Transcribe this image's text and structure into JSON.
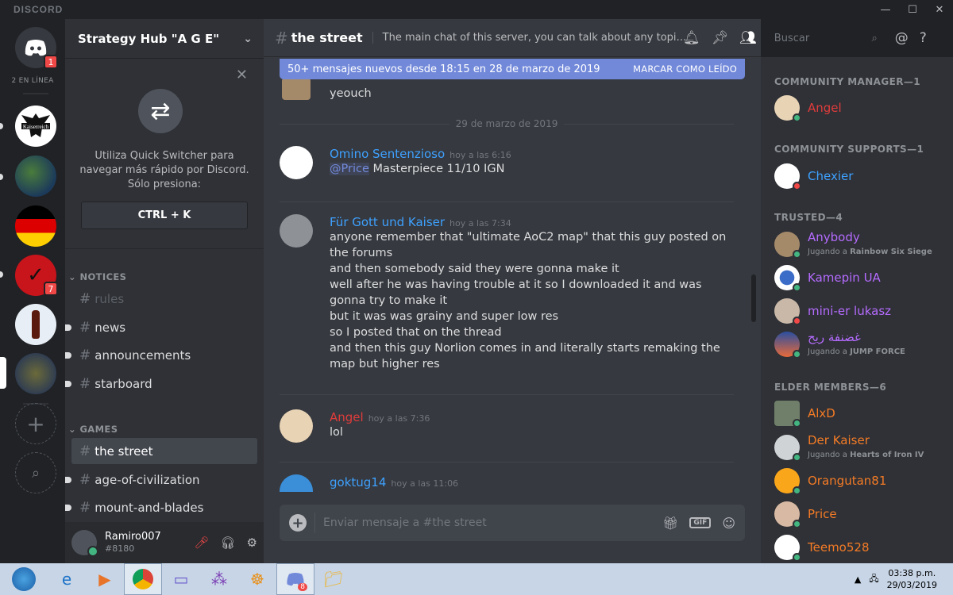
{
  "window": {
    "brand": "DISCORD"
  },
  "servers": {
    "home_badge": "1",
    "online_label": "2 EN LÍNEA",
    "server_badge": "7",
    "items": [
      "Kaiserreich",
      "Earth",
      "Germany",
      "Server",
      "Cola",
      "World map"
    ]
  },
  "guild": {
    "name": "Strategy Hub \"A G E\""
  },
  "quick_switcher": {
    "text": "Utiliza Quick Switcher para navegar más rápido por Discord. Sólo presiona:",
    "shortcut": "CTRL + K"
  },
  "categories": [
    {
      "name": "NOTICES",
      "channels": [
        "rules",
        "news",
        "announcements",
        "starboard"
      ]
    },
    {
      "name": "GAMES",
      "channels": [
        "the street",
        "age-of-civilization",
        "mount-and-blades"
      ]
    }
  ],
  "user": {
    "name": "Ramiro007",
    "discriminator": "#8180"
  },
  "channel": {
    "name": "the street",
    "topic": "The main chat of this server, you can talk about any topic allow..."
  },
  "new_messages_bar": {
    "text": "50+ mensajes nuevos desde 18:15 en 28 de marzo de 2019",
    "action": "MARCAR COMO LEÍDO"
  },
  "date_divider": "29 de marzo de 2019",
  "messages": [
    {
      "author": "",
      "time": "",
      "lines": [
        "yeouch"
      ]
    },
    {
      "author": "Omino Sentenzioso",
      "time": "hoy a las 6:16",
      "mention": "@Price",
      "lines": [
        "Masterpiece 11/10 IGN"
      ],
      "color": "#3ea1ff"
    },
    {
      "author": "Für Gott und Kaiser",
      "time": "hoy a las 7:34",
      "color": "#3ea1ff",
      "lines": [
        "anyone remember that \"ultimate AoC2 map\" that this guy posted on the forums",
        "and then somebody said they were gonna make it",
        "well after he was having trouble at it so I downloaded it and was gonna try to make it",
        "but it was was grainy and super low res",
        "so I posted that on the thread",
        "and then this guy Norlion comes in and literally starts remaking the map but higher res"
      ]
    },
    {
      "author": "Angel",
      "time": "hoy a las 7:36",
      "color": "#e03c3c",
      "lines": [
        "lol"
      ]
    },
    {
      "author": "goktug14",
      "time": "hoy a las 11:06",
      "color": "#3ea1ff",
      "lines": []
    }
  ],
  "composer": {
    "placeholder": "Enviar mensaje a #the street"
  },
  "search": {
    "placeholder": "Buscar"
  },
  "member_groups": [
    {
      "title": "COMMUNITY MANAGER—1",
      "members": [
        {
          "name": "Angel",
          "color": "#e03c3c",
          "status": "online",
          "activity": "",
          "game": ""
        }
      ]
    },
    {
      "title": "COMMUNITY SUPPORTS—1",
      "members": [
        {
          "name": "Chexier",
          "color": "#3ea1ff",
          "status": "dnd",
          "activity": "",
          "game": ""
        }
      ]
    },
    {
      "title": "TRUSTED—4",
      "members": [
        {
          "name": "Anybody",
          "color": "#b56bff",
          "status": "online",
          "activity": "Jugando a ",
          "game": "Rainbow Six Siege"
        },
        {
          "name": "Kamepin UA",
          "color": "#b56bff",
          "status": "online",
          "activity": "",
          "game": ""
        },
        {
          "name": "mini-er lukasz",
          "color": "#b56bff",
          "status": "dnd",
          "activity": "",
          "game": ""
        },
        {
          "name": "غضنفة ريح",
          "color": "#b56bff",
          "status": "online",
          "activity": "Jugando a ",
          "game": "JUMP FORCE"
        }
      ]
    },
    {
      "title": "ELDER MEMBERS—6",
      "members": [
        {
          "name": "AlxD",
          "color": "#f47b26",
          "status": "online",
          "activity": "",
          "game": ""
        },
        {
          "name": "Der Kaiser",
          "color": "#f47b26",
          "status": "online",
          "activity": "Jugando a ",
          "game": "Hearts of Iron IV"
        },
        {
          "name": "Orangutan81",
          "color": "#f47b26",
          "status": "online",
          "activity": "",
          "game": ""
        },
        {
          "name": "Price",
          "color": "#f47b26",
          "status": "online",
          "activity": "",
          "game": ""
        },
        {
          "name": "Teemo528",
          "color": "#f47b26",
          "status": "online",
          "activity": "",
          "game": ""
        }
      ]
    }
  ],
  "taskbar": {
    "discord_badge": "8",
    "time": "03:38 p.m.",
    "date": "29/03/2019"
  }
}
